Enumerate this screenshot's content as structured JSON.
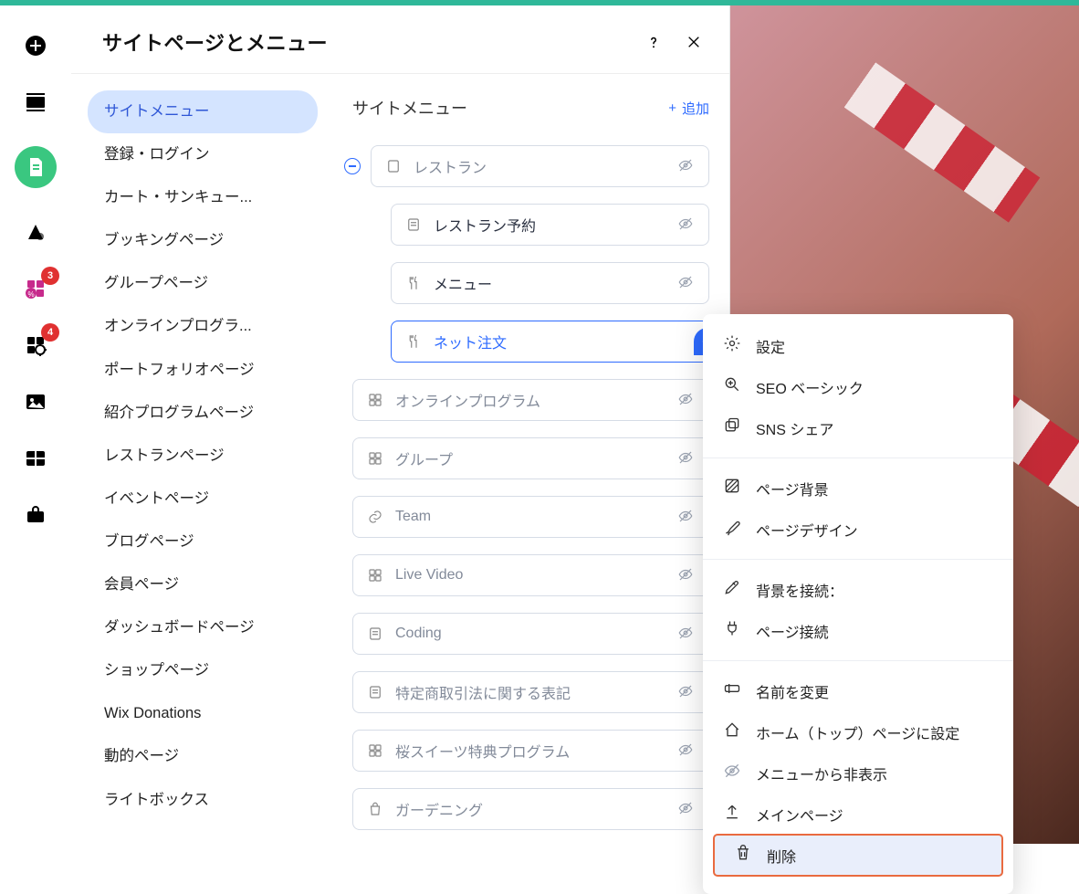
{
  "panel": {
    "title": "サイトページとメニュー"
  },
  "sidebar": {
    "items": [
      {
        "label": "サイトメニュー",
        "active": true
      },
      {
        "label": "登録・ログイン"
      },
      {
        "label": "カート・サンキュー..."
      },
      {
        "label": "ブッキングページ"
      },
      {
        "label": "グループページ"
      },
      {
        "label": "オンラインプログラ..."
      },
      {
        "label": "ポートフォリオページ"
      },
      {
        "label": "紹介プログラムページ"
      },
      {
        "label": "レストランページ"
      },
      {
        "label": "イベントページ"
      },
      {
        "label": "ブログページ"
      },
      {
        "label": "会員ページ"
      },
      {
        "label": "ダッシュボードページ"
      },
      {
        "label": "ショップページ"
      },
      {
        "label": "Wix Donations"
      },
      {
        "label": "動的ページ"
      },
      {
        "label": "ライトボックス"
      }
    ]
  },
  "content": {
    "title": "サイトメニュー",
    "add_label": "追加",
    "pages": {
      "top": {
        "label": "レストラン"
      },
      "children": [
        {
          "label": "レストラン予約",
          "icon": "doc"
        },
        {
          "label": "メニュー",
          "icon": "fork"
        },
        {
          "label": "ネット注文",
          "icon": "fork",
          "active": true
        }
      ],
      "rest": [
        {
          "label": "オンラインプログラム",
          "icon": "grid"
        },
        {
          "label": "グループ",
          "icon": "grid"
        },
        {
          "label": "Team",
          "icon": "link"
        },
        {
          "label": "Live Video",
          "icon": "grid"
        },
        {
          "label": "Coding",
          "icon": "doc"
        },
        {
          "label": "特定商取引法に関する表記",
          "icon": "doc"
        },
        {
          "label": "桜スイーツ特典プログラム",
          "icon": "grid"
        },
        {
          "label": "ガーデニング",
          "icon": "bag"
        }
      ]
    }
  },
  "ctx": {
    "groups": [
      [
        {
          "label": "設定",
          "icon": "gear"
        },
        {
          "label": "SEO ベーシック",
          "icon": "seo"
        },
        {
          "label": "SNS シェア",
          "icon": "share"
        }
      ],
      [
        {
          "label": "ページ背景",
          "icon": "diag"
        },
        {
          "label": "ページデザイン",
          "icon": "brush"
        }
      ],
      [
        {
          "label": "背景を接続：",
          "icon": "pen"
        },
        {
          "label": "ページ接続",
          "icon": "plug"
        }
      ],
      [
        {
          "label": "名前を変更",
          "icon": "rename"
        },
        {
          "label": "ホーム（トップ）ページに設定",
          "icon": "home"
        },
        {
          "label": "メニューから非表示",
          "icon": "hide"
        },
        {
          "label": "メインページ",
          "icon": "up"
        },
        {
          "label": "削除",
          "icon": "trash",
          "delete": true
        }
      ]
    ]
  },
  "rail": {
    "badge_apps": "3",
    "badge_tools": "4"
  }
}
